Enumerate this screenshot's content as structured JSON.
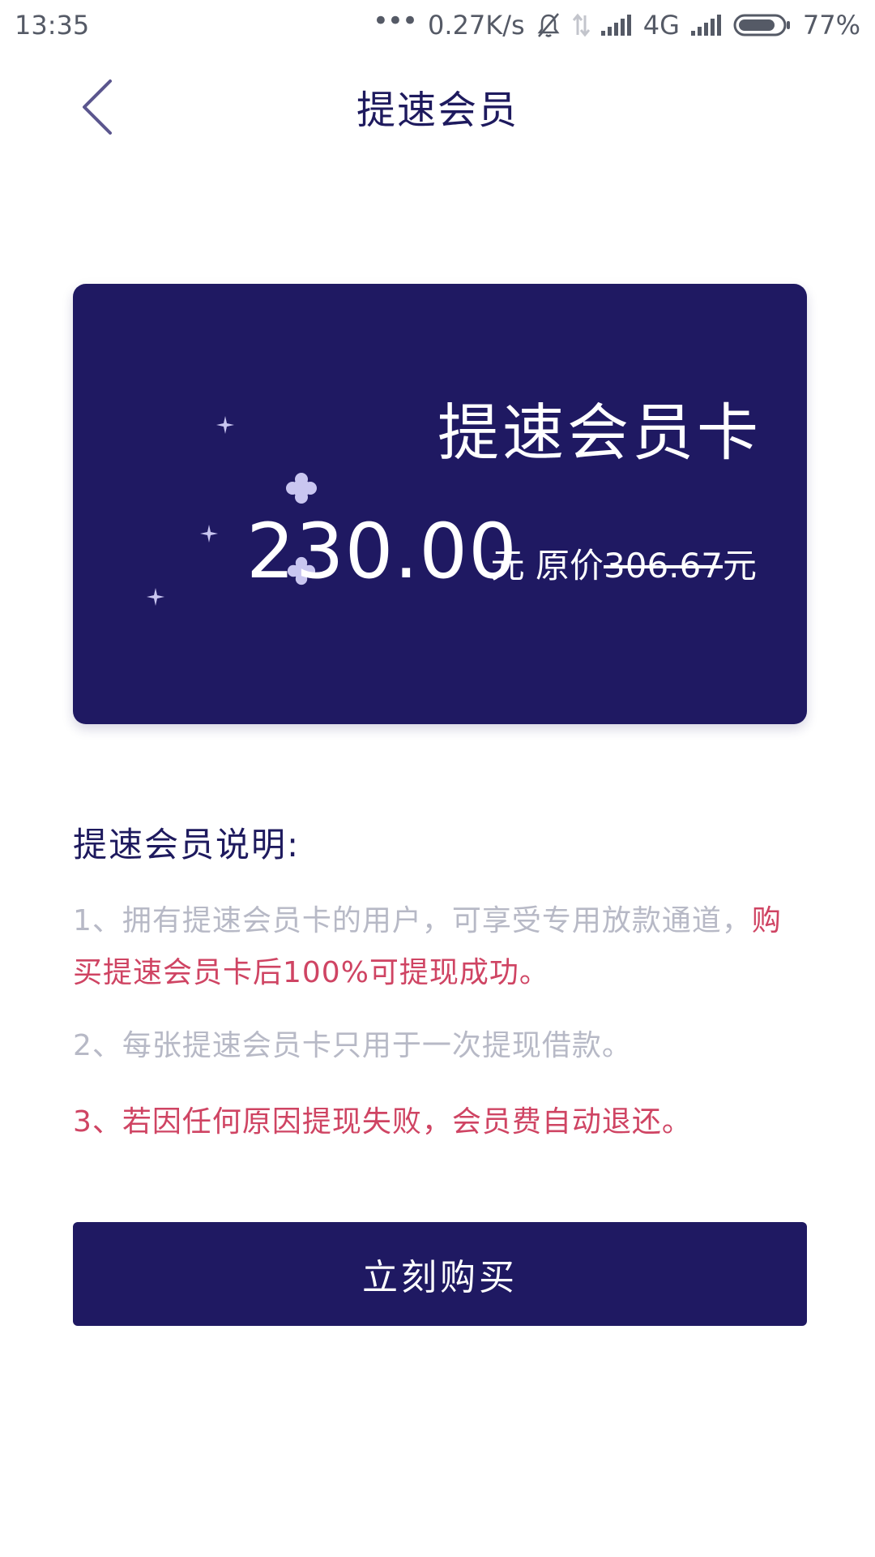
{
  "status_bar": {
    "time": "13:35",
    "dots": "•••",
    "network_speed": "0.27K/s",
    "network_type": "4G",
    "battery": "77%"
  },
  "nav": {
    "title": "提速会员",
    "back_icon": "chevron-left-icon"
  },
  "card": {
    "title": "提速会员卡",
    "price": "230.00",
    "unit": "元",
    "original_prefix": "原价",
    "original_price": "306.67",
    "original_unit": "元"
  },
  "description": {
    "title": "提速会员说明:",
    "item1_normal": "1、拥有提速会员卡的用户，可享受专用放款通道，",
    "item1_highlight": "购买提速会员卡后100%可提现成功。",
    "item2": "2、每张提速会员卡只用于一次提现借款。",
    "item3": "3、若因任何原因提现失败，会员费自动退还。"
  },
  "buy_button": {
    "label": "立刻购买"
  },
  "colors": {
    "primary": "#1f1962",
    "title_text": "#1e1a5e",
    "muted_text": "#b7b9c6",
    "highlight_red": "#cf4463",
    "sparkle": "#c9c6f0"
  }
}
